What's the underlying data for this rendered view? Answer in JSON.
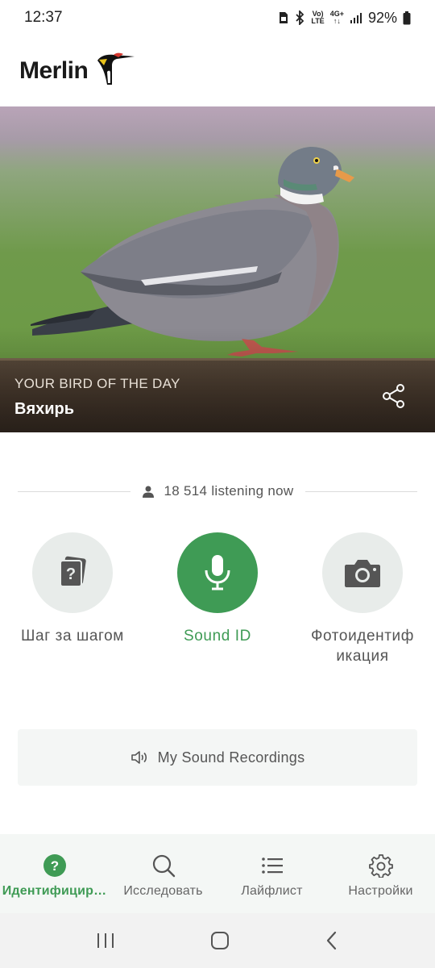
{
  "status": {
    "time": "12:37",
    "network_top": "Vo)",
    "network_bottom": "LTE",
    "gen_top": "4G+",
    "gen_bottom": "↑↓",
    "battery": "92%"
  },
  "app": {
    "name": "Merlin"
  },
  "bird_of_day": {
    "kicker": "YOUR BIRD OF THE DAY",
    "name": "Вяхирь"
  },
  "listening": {
    "text": "18 514 listening now"
  },
  "modes": [
    {
      "label": "Шаг за шагом",
      "icon": "cards-question-icon"
    },
    {
      "label": "Sound ID",
      "icon": "microphone-icon"
    },
    {
      "label": "Фотоидентиф икация",
      "icon": "camera-icon"
    }
  ],
  "recordings": {
    "label": "My Sound Recordings"
  },
  "nav": [
    {
      "label": "Идентифицир…",
      "icon": "question-circle-icon"
    },
    {
      "label": "Исследовать",
      "icon": "search-icon"
    },
    {
      "label": "Лайфлист",
      "icon": "list-icon"
    },
    {
      "label": "Настройки",
      "icon": "gear-icon"
    }
  ],
  "colors": {
    "accent": "#3f9b55",
    "circle": "#e8ecea",
    "nav_bg": "#f4f7f5"
  }
}
